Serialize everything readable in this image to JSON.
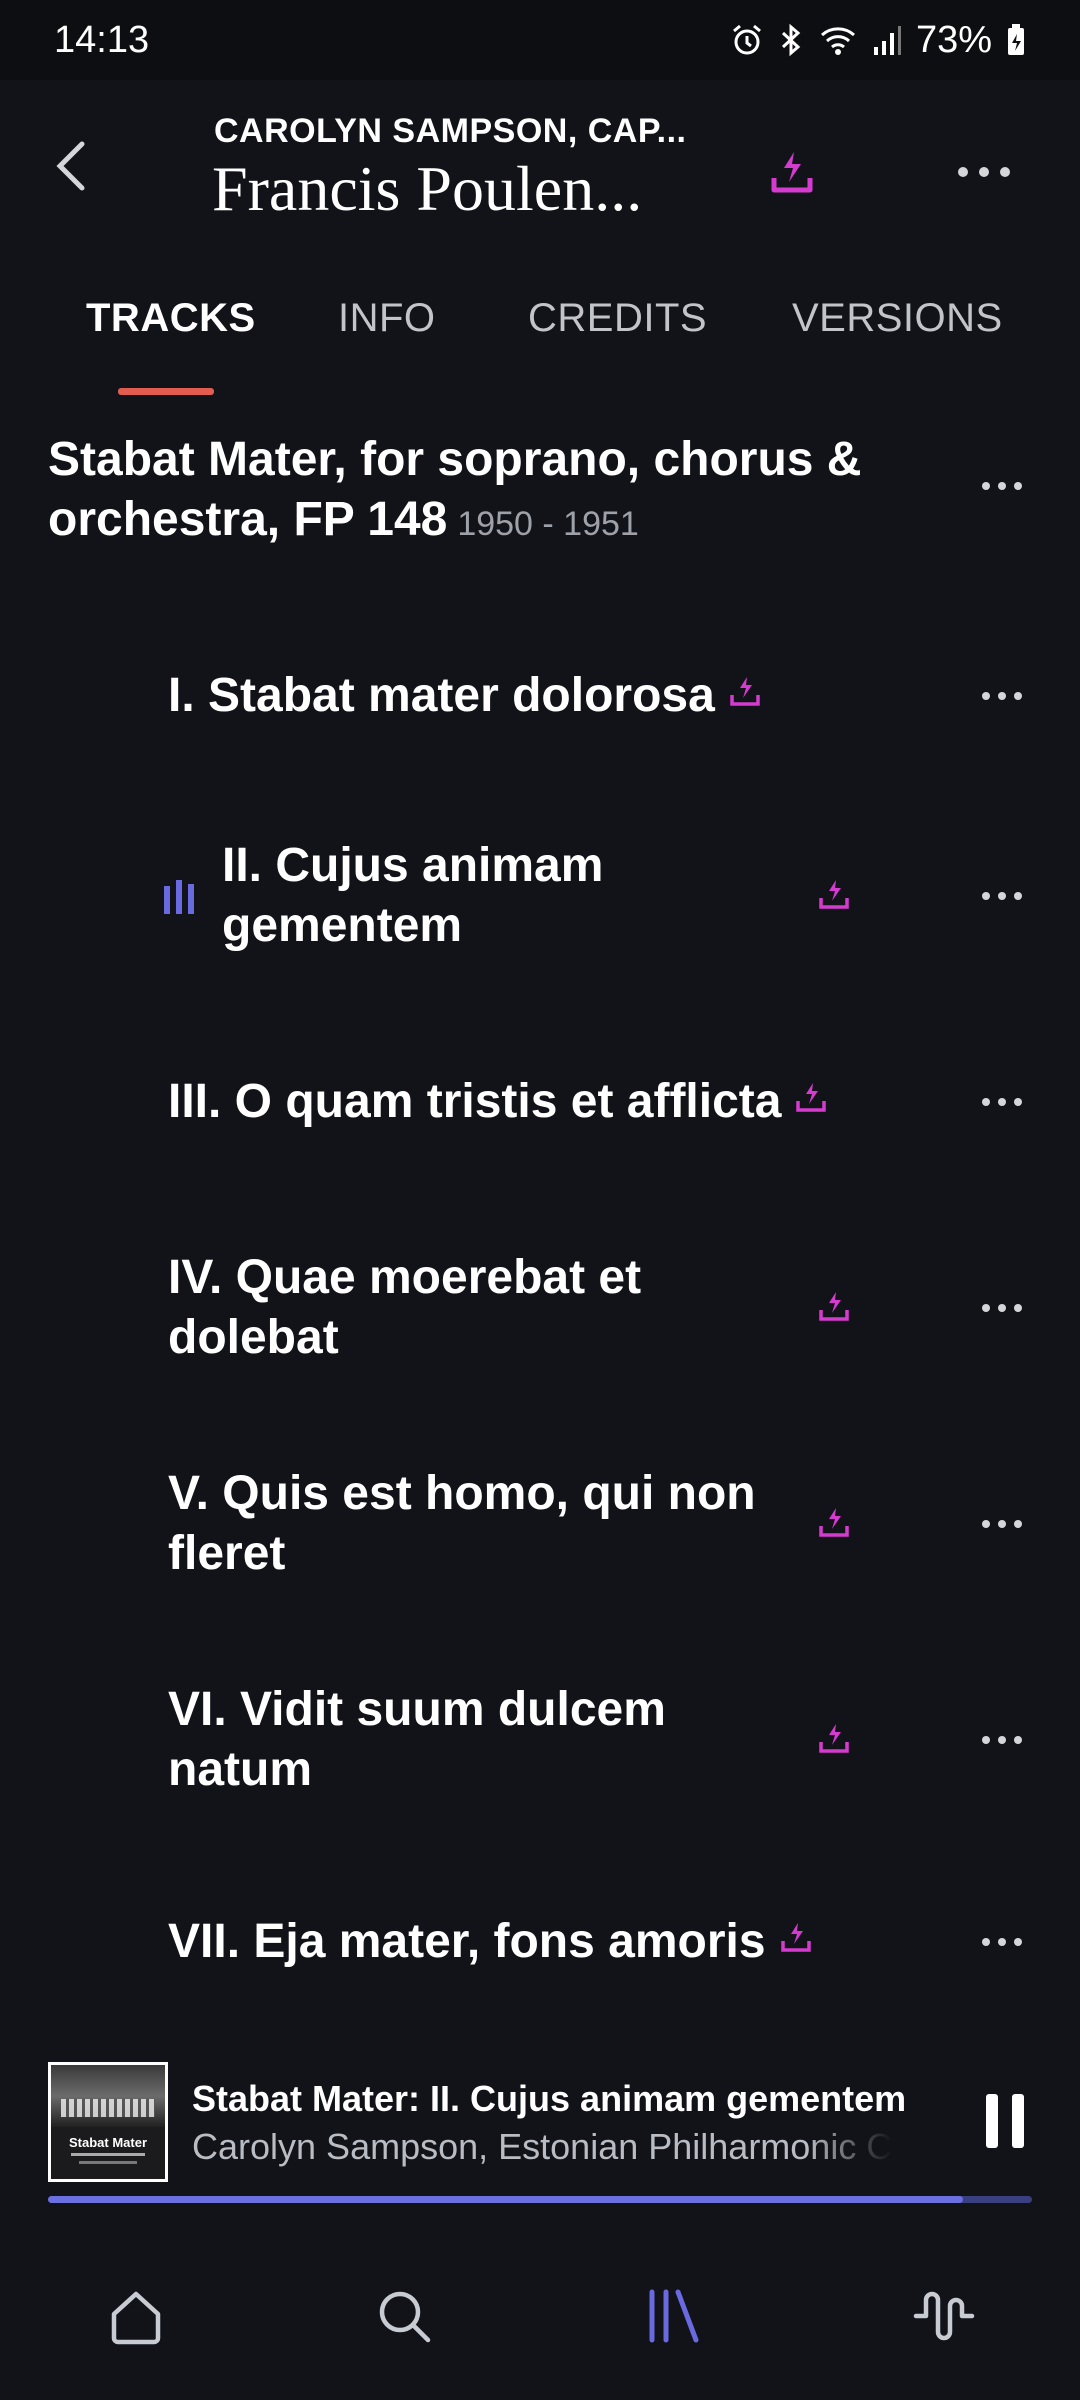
{
  "status_bar": {
    "time": "14:13",
    "battery": "73%",
    "icons": [
      "alarm-icon",
      "bluetooth-icon",
      "wifi-icon",
      "signal-icon",
      "battery-icon"
    ]
  },
  "header": {
    "subtitle": "CAROLYN SAMPSON, CAP...",
    "title": "Francis Poulen...",
    "icons": [
      "back-arrow-icon",
      "download-icon",
      "more-icon"
    ]
  },
  "tabs": [
    {
      "label": "TRACKS",
      "active": true
    },
    {
      "label": "INFO",
      "active": false
    },
    {
      "label": "CREDITS",
      "active": false
    },
    {
      "label": "VERSIONS",
      "active": false
    }
  ],
  "work": {
    "title": "Stabat Mater, for soprano, chorus & orchestra, FP 148",
    "years": "1950 - 1951"
  },
  "tracks": [
    {
      "title": "I. Stabat mater dolorosa",
      "playing": false
    },
    {
      "title": "II. Cujus animam gementem",
      "playing": true
    },
    {
      "title": "III. O quam tristis et afflicta",
      "playing": false
    },
    {
      "title": "IV. Quae moerebat et dolebat",
      "playing": false
    },
    {
      "title": "V. Quis est homo, qui non fleret",
      "playing": false
    },
    {
      "title": "VI. Vidit suum dulcem natum",
      "playing": false
    },
    {
      "title": "VII. Eja mater, fons amoris",
      "playing": false
    }
  ],
  "now_playing": {
    "cover_text": "Stabat Mater",
    "title": "Stabat Mater: II. Cujus animam gementem",
    "artist": "Carolyn Sampson, Estonian Philharmonic Chamber Choir",
    "progress": 0.93
  },
  "bottom_nav": [
    {
      "name": "home-icon",
      "active": false
    },
    {
      "name": "search-icon",
      "active": false
    },
    {
      "name": "library-icon",
      "active": true
    },
    {
      "name": "activity-icon",
      "active": false
    }
  ],
  "colors": {
    "background": "#111319",
    "accent_download": "#d63bd0",
    "accent_active": "#6a6ae0",
    "tab_underline": "#e25d4f"
  }
}
